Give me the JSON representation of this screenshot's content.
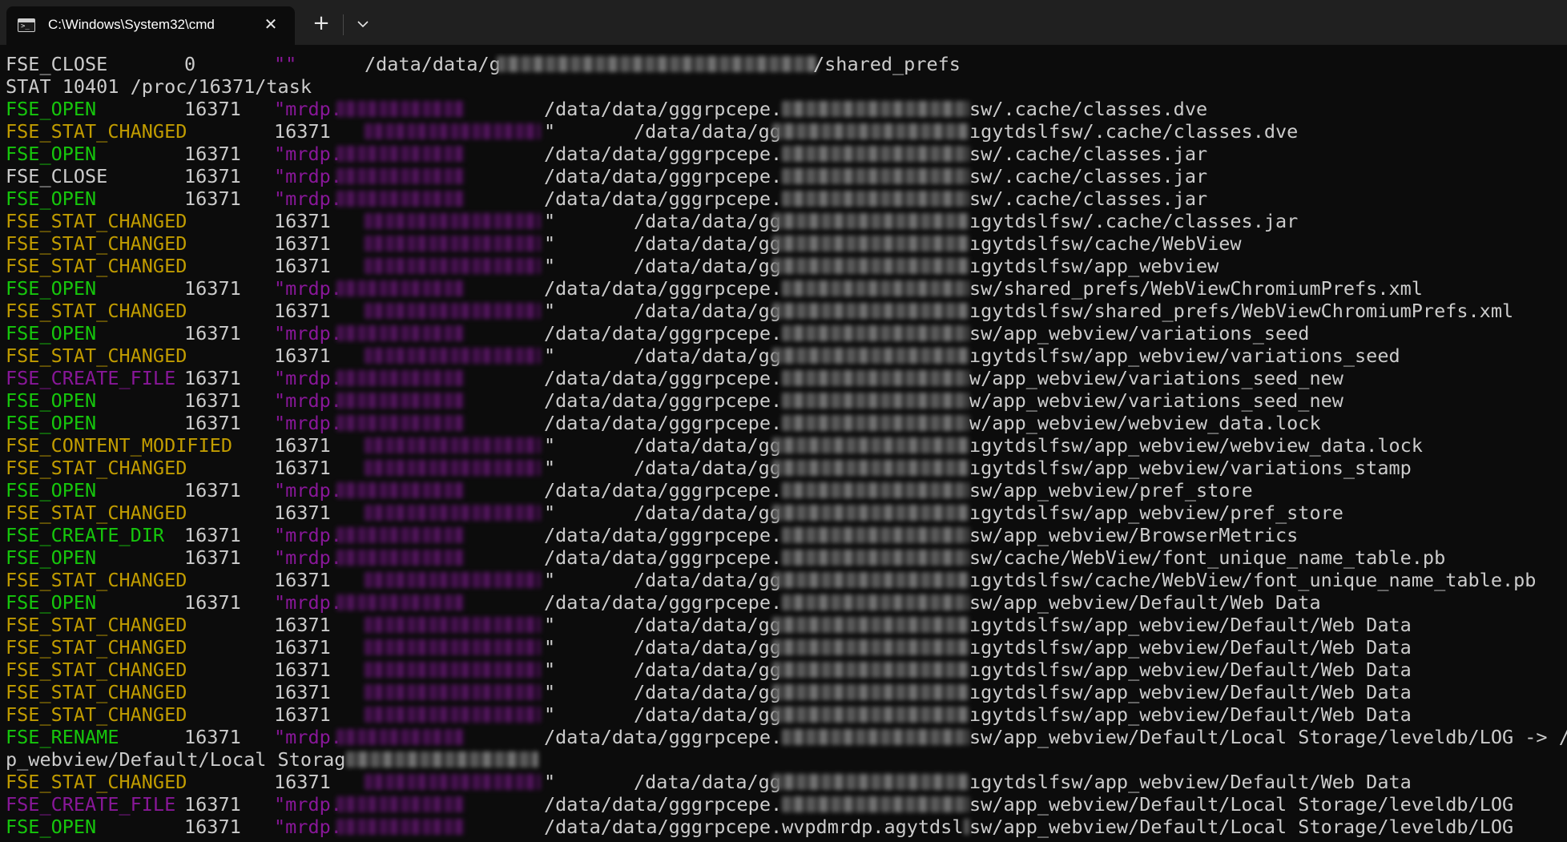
{
  "window": {
    "tab_title": "C:\\Windows\\System32\\cmd",
    "tab_icon": "terminal-icon",
    "close_icon": "close-icon",
    "new_tab_label": "+",
    "dropdown_icon": "chevron-down-icon"
  },
  "colors": {
    "background": "#0c0c0c",
    "tabbar": "#202020",
    "green": "#16c60c",
    "yellow": "#c19c00",
    "purple": "#881798",
    "white": "#cccccc"
  },
  "console": {
    "lines": [
      {
        "event": "FSE_CLOSE",
        "color": "white",
        "pid": "0",
        "proc": "\"\"",
        "path": "/data/data/g",
        "path_style": "wide",
        "tail": "/shared_prefs"
      },
      {
        "raw": "STAT 10401 /proc/16371/task"
      },
      {
        "event": "FSE_OPEN",
        "color": "green",
        "pid": "16371",
        "proc": "\"mrdp.",
        "path": "/data/data/gggrpcepe.",
        "path_style": "a",
        "tail": "sw/.cache/classes.dve"
      },
      {
        "event": "FSE_STAT_CHANGED",
        "color": "yellow",
        "pid": "",
        "proc": "16371",
        "path": "\"",
        "path_style": "b",
        "path2": "/data/data/gg",
        "tail": "ıgytdslfsw/.cache/classes.dve"
      },
      {
        "event": "FSE_OPEN",
        "color": "green",
        "pid": "16371",
        "proc": "\"mrdp.",
        "path": "/data/data/gggrpcepe.",
        "path_style": "a",
        "tail": "sw/.cache/classes.jar"
      },
      {
        "event": "FSE_CLOSE",
        "color": "white",
        "pid": "16371",
        "proc": "\"mrdp.",
        "path": "/data/data/gggrpcepe.",
        "path_style": "a",
        "tail": "sw/.cache/classes.jar"
      },
      {
        "event": "FSE_OPEN",
        "color": "green",
        "pid": "16371",
        "proc": "\"mrdp.",
        "path": "/data/data/gggrpcepe.",
        "path_style": "a",
        "tail": "sw/.cache/classes.jar"
      },
      {
        "event": "FSE_STAT_CHANGED",
        "color": "yellow",
        "pid": "",
        "proc": "16371",
        "path": "\"",
        "path_style": "b",
        "path2": "/data/data/gg",
        "tail": "ıgytdslfsw/.cache/classes.jar"
      },
      {
        "event": "FSE_STAT_CHANGED",
        "color": "yellow",
        "pid": "",
        "proc": "16371",
        "path": "\"",
        "path_style": "b",
        "path2": "/data/data/gg",
        "tail": "ıgytdslfsw/cache/WebView"
      },
      {
        "event": "FSE_STAT_CHANGED",
        "color": "yellow",
        "pid": "",
        "proc": "16371",
        "path": "\"",
        "path_style": "b",
        "path2": "/data/data/gg",
        "tail": "ıgytdslfsw/app_webview"
      },
      {
        "event": "FSE_OPEN",
        "color": "green",
        "pid": "16371",
        "proc": "\"mrdp.",
        "path": "/data/data/gggrpcepe.",
        "path_style": "a",
        "tail": "sw/shared_prefs/WebViewChromiumPrefs.xml"
      },
      {
        "event": "FSE_STAT_CHANGED",
        "color": "yellow",
        "pid": "",
        "proc": "16371",
        "path": "\"",
        "path_style": "b",
        "path2": "/data/data/gg",
        "tail": "ıgytdslfsw/shared_prefs/WebViewChromiumPrefs.xml"
      },
      {
        "event": "FSE_OPEN",
        "color": "green",
        "pid": "16371",
        "proc": "\"mrdp.",
        "path": "/data/data/gggrpcepe.",
        "path_style": "a",
        "tail": "sw/app_webview/variations_seed"
      },
      {
        "event": "FSE_STAT_CHANGED",
        "color": "yellow",
        "pid": "",
        "proc": "16371",
        "path": "\"",
        "path_style": "b",
        "path2": "/data/data/gg",
        "tail": "ıgytdslfsw/app_webview/variations_seed"
      },
      {
        "event": "FSE_CREATE_FILE",
        "color": "purple",
        "pid": "16371",
        "proc": "\"mrdp.",
        "path": "/data/data/gggrpcepe.",
        "path_style": "a",
        "tail": "w/app_webview/variations_seed_new"
      },
      {
        "event": "FSE_OPEN",
        "color": "green",
        "pid": "16371",
        "proc": "\"mrdp.",
        "path": "/data/data/gggrpcepe.",
        "path_style": "a",
        "tail": "w/app_webview/variations_seed_new"
      },
      {
        "event": "FSE_OPEN",
        "color": "green",
        "pid": "16371",
        "proc": "\"mrdp.",
        "path": "/data/data/gggrpcepe.",
        "path_style": "a",
        "tail": "w/app_webview/webview_data.lock"
      },
      {
        "event": "FSE_CONTENT_MODIFIED",
        "color": "yellow",
        "pid": "",
        "proc": "16371",
        "path": "\"",
        "path_style": "b",
        "path2": "/data/data/gg",
        "tail": "ıgytdslfsw/app_webview/webview_data.lock"
      },
      {
        "event": "FSE_STAT_CHANGED",
        "color": "yellow",
        "pid": "",
        "proc": "16371",
        "path": "\"",
        "path_style": "b",
        "path2": "/data/data/gg",
        "tail": "ıgytdslfsw/app_webview/variations_stamp"
      },
      {
        "event": "FSE_OPEN",
        "color": "green",
        "pid": "16371",
        "proc": "\"mrdp.",
        "path": "/data/data/gggrpcepe.",
        "path_style": "a",
        "tail": "sw/app_webview/pref_store"
      },
      {
        "event": "FSE_STAT_CHANGED",
        "color": "yellow",
        "pid": "",
        "proc": "16371",
        "path": "\"",
        "path_style": "b",
        "path2": "/data/data/gg",
        "tail": "ıgytdslfsw/app_webview/pref_store"
      },
      {
        "event": "FSE_CREATE_DIR",
        "color": "green",
        "pid": "16371",
        "proc": "\"mrdp.",
        "path": "/data/data/gggrpcepe.",
        "path_style": "a",
        "tail": "sw/app_webview/BrowserMetrics"
      },
      {
        "event": "FSE_OPEN",
        "color": "green",
        "pid": "16371",
        "proc": "\"mrdp.",
        "path": "/data/data/gggrpcepe.",
        "path_style": "a",
        "tail": "sw/cache/WebView/font_unique_name_table.pb"
      },
      {
        "event": "FSE_STAT_CHANGED",
        "color": "yellow",
        "pid": "",
        "proc": "16371",
        "path": "\"",
        "path_style": "b",
        "path2": "/data/data/gg",
        "tail": "ıgytdslfsw/cache/WebView/font_unique_name_table.pb"
      },
      {
        "event": "FSE_OPEN",
        "color": "green",
        "pid": "16371",
        "proc": "\"mrdp.",
        "path": "/data/data/gggrpcepe.",
        "path_style": "a",
        "tail": "sw/app_webview/Default/Web Data"
      },
      {
        "event": "FSE_STAT_CHANGED",
        "color": "yellow",
        "pid": "",
        "proc": "16371",
        "path": "\"",
        "path_style": "b",
        "path2": "/data/data/gg",
        "tail": "ıgytdslfsw/app_webview/Default/Web Data"
      },
      {
        "event": "FSE_STAT_CHANGED",
        "color": "yellow",
        "pid": "",
        "proc": "16371",
        "path": "\"",
        "path_style": "b",
        "path2": "/data/data/gg",
        "tail": "ıgytdslfsw/app_webview/Default/Web Data"
      },
      {
        "event": "FSE_STAT_CHANGED",
        "color": "yellow",
        "pid": "",
        "proc": "16371",
        "path": "\"",
        "path_style": "b",
        "path2": "/data/data/gg",
        "tail": "ıgytdslfsw/app_webview/Default/Web Data"
      },
      {
        "event": "FSE_STAT_CHANGED",
        "color": "yellow",
        "pid": "",
        "proc": "16371",
        "path": "\"",
        "path_style": "b",
        "path2": "/data/data/gg",
        "tail": "ıgytdslfsw/app_webview/Default/Web Data"
      },
      {
        "event": "FSE_STAT_CHANGED",
        "color": "yellow",
        "pid": "",
        "proc": "16371",
        "path": "\"",
        "path_style": "b",
        "path2": "/data/data/gg",
        "tail": "ıgytdslfsw/app_webview/Default/Web Data"
      },
      {
        "event": "FSE_RENAME",
        "color": "green",
        "pid": "16371",
        "proc": "\"mrdp.",
        "path": "/data/data/gggrpcepe.",
        "path_style": "a",
        "tail": "sw/app_webview/Default/Local Storage/leveldb/LOG -> /d"
      },
      {
        "raw": "p_webview/Default/Local Storag",
        "blur_after": true
      },
      {
        "event": "FSE_STAT_CHANGED",
        "color": "yellow",
        "pid": "",
        "proc": "16371",
        "path": "\"",
        "path_style": "b",
        "path2": "/data/data/gg",
        "tail": "ıgytdslfsw/app_webview/Default/Web Data"
      },
      {
        "event": "FSE_CREATE_FILE",
        "color": "purple",
        "pid": "16371",
        "proc": "\"mrdp.",
        "path": "/data/data/gggrpcepe.",
        "path_style": "a",
        "tail": "sw/app_webview/Default/Local Storage/leveldb/LOG"
      },
      {
        "event": "FSE_OPEN",
        "color": "green",
        "pid": "16371",
        "proc": "\"mrdp.",
        "path": "/data/data/gggrpcepe.wvpdmrdp.agytdsl",
        "path_style": "a",
        "tail": "sw/app_webview/Default/Local Storage/leveldb/LOG"
      }
    ]
  }
}
